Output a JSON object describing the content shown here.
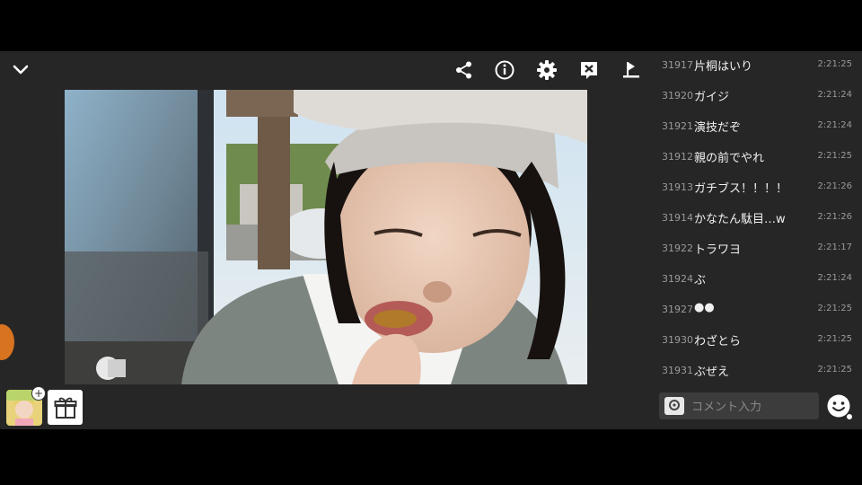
{
  "header": {
    "collapse_icon": "chevron-down-icon",
    "toolbar": [
      "share-icon",
      "info-icon",
      "gear-icon",
      "close-box-icon",
      "sort-icon"
    ]
  },
  "comments": [
    {
      "num": "31917",
      "text": "片桐はいり",
      "time": "2:21:25"
    },
    {
      "num": "31920",
      "text": "ガイジ",
      "time": "2:21:24"
    },
    {
      "num": "31921",
      "text": "演技だぞ",
      "time": "2:21:24"
    },
    {
      "num": "31912",
      "text": "親の前でやれ",
      "time": "2:21:25"
    },
    {
      "num": "31913",
      "text": "ガチブス！！！！",
      "time": "2:21:26"
    },
    {
      "num": "31914",
      "text": "かなたん駄目…w",
      "time": "2:21:26"
    },
    {
      "num": "31922",
      "text": "トラワヨ",
      "time": "2:21:17"
    },
    {
      "num": "31924",
      "text": "ぶ",
      "time": "2:21:24"
    },
    {
      "num": "31927",
      "text": "●●",
      "time": "2:21:25"
    },
    {
      "num": "31930",
      "text": "わざとら",
      "time": "2:21:25"
    },
    {
      "num": "31931",
      "text": "ぶぜえ",
      "time": "2:21:25"
    }
  ],
  "comment_input": {
    "placeholder": "コメント入力"
  },
  "colors": {
    "bg": "#262626",
    "accent_orange": "#d8731f"
  }
}
